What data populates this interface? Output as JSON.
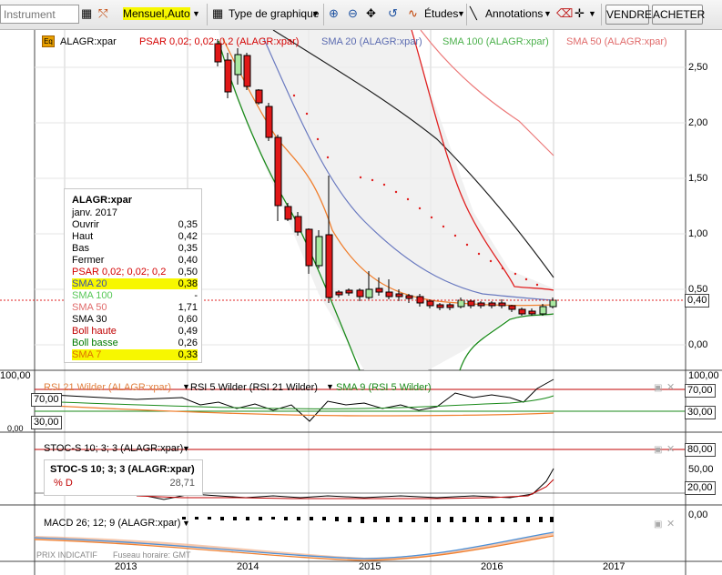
{
  "toolbar": {
    "instrument_placeholder": "Instrument",
    "period": "Mensuel,",
    "auto": "Auto",
    "chart_type": "Type de graphique",
    "studies": "Études",
    "annotations": "Annotations",
    "sell": "VENDRE",
    "buy": "ACHETER"
  },
  "main_legend": {
    "instrument": "ALAGR:xpar",
    "psar": "PSAR 0,02; 0,02; 0,2 (ALAGR:xpar)",
    "sma20": "SMA 20 (ALAGR:xpar)",
    "sma100": "SMA 100 (ALAGR:xpar)",
    "sma50": "SMA 50 (ALAGR:xpar)"
  },
  "main_axis": [
    "2,50",
    "2,00",
    "1,50",
    "1,00",
    "0,50",
    "0,00"
  ],
  "last_price": "0,40",
  "infobox": {
    "title": "ALAGR:xpar",
    "date": "janv. 2017",
    "rows": [
      {
        "label": "Ouvrir",
        "value": "0,35",
        "color": "#000000"
      },
      {
        "label": "Haut",
        "value": "0,42",
        "color": "#000000"
      },
      {
        "label": "Bas",
        "value": "0,35",
        "color": "#000000"
      },
      {
        "label": "Fermer",
        "value": "0,40",
        "color": "#000000"
      },
      {
        "label": "PSAR 0,02; 0,02; 0,2",
        "value": "0,50",
        "color": "#d40000"
      },
      {
        "label": "SMA 20",
        "value": "0,38",
        "color": "#3b4fa6"
      },
      {
        "label": "SMA 100",
        "value": "-",
        "color": "#59c859"
      },
      {
        "label": "SMA 50",
        "value": "1,71",
        "color": "#e06a6a"
      },
      {
        "label": "SMA 30",
        "value": "0,60",
        "color": "#000000"
      },
      {
        "label": "Boll haute",
        "value": "0,49",
        "color": "#c00000"
      },
      {
        "label": "Boll basse",
        "value": "0,26",
        "color": "#007a00"
      },
      {
        "label": "SMA 7",
        "value": "0,33",
        "color": "#e07000"
      }
    ]
  },
  "rsi": {
    "legend1": "RSI 21 Wilder (ALAGR:xpar)",
    "legend2": "RSI 5 Wilder (RSI 21 Wilder)",
    "legend3": "SMA 9 (RSI 5 Wilder)",
    "axis_top": "100,00",
    "axis_70": "70,00",
    "axis_30": "30,00",
    "axis_0": "0,00"
  },
  "stoch": {
    "legend": "STOC-S 10; 3; 3 (ALAGR:xpar)",
    "box_title": "STOC-S 10; 3; 3 (ALAGR:xpar)",
    "box_label": "% D",
    "box_value": "28,71",
    "axis_80": "80,00",
    "axis_50": "50,00",
    "axis_20": "20,00"
  },
  "macd": {
    "legend": "MACD 26; 12; 9 (ALAGR:xpar)",
    "axis_0": "0,00",
    "footer_price": "PRIX INDICATIF",
    "footer_tz": "Fuseau horaire: GMT"
  },
  "x_axis": [
    "2013",
    "2014",
    "2015",
    "2016",
    "2017"
  ],
  "colors": {
    "up_candle": "#a8e8a0",
    "down_candle": "#e01818",
    "psar": "#e02020",
    "sma20": "#6a7ac0",
    "sma50": "#ec7a7a",
    "sma30": "#202020",
    "boll_upper": "#e02020",
    "boll_lower": "#1a8a1a",
    "sma7": "#f08030",
    "highlight": "#f7f700"
  }
}
